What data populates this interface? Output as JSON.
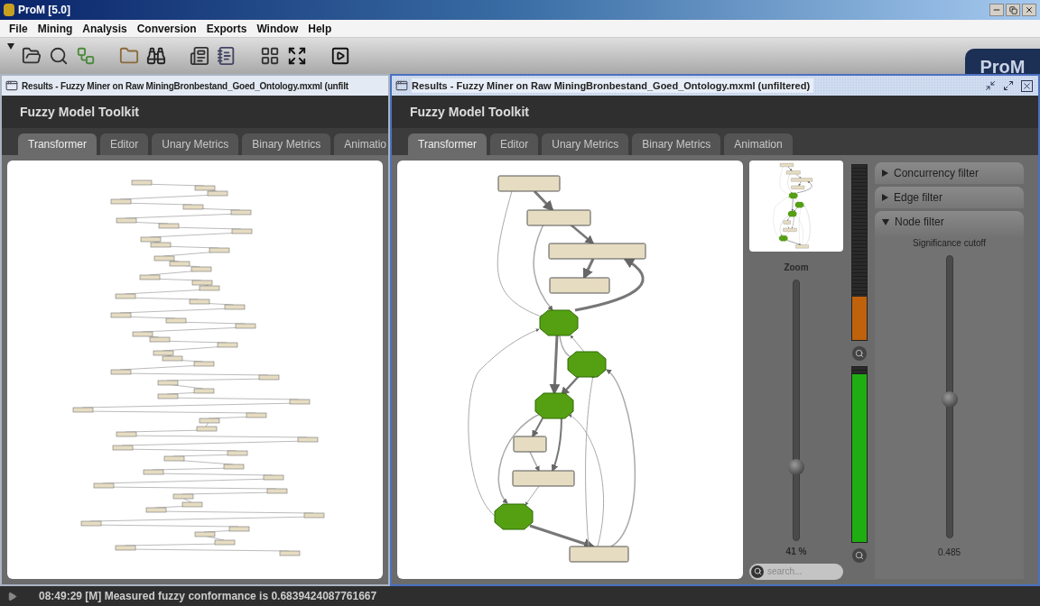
{
  "window": {
    "title": "ProM [5.0]"
  },
  "menu": [
    "File",
    "Mining",
    "Analysis",
    "Conversion",
    "Exports",
    "Window",
    "Help"
  ],
  "logo": "ProM",
  "frames": [
    {
      "title": "Results - Fuzzy Miner on Raw MiningBronbestand_Goed_Ontology.mxml (unfilt",
      "active": false,
      "toolkit": "Fuzzy Model Toolkit",
      "tabs": [
        {
          "label": "Transformer",
          "selected": true
        },
        {
          "label": "Editor",
          "selected": false
        },
        {
          "label": "Unary Metrics",
          "selected": false
        },
        {
          "label": "Binary Metrics",
          "selected": false
        },
        {
          "label": "Animatio",
          "selected": false
        }
      ]
    },
    {
      "title": "Results - Fuzzy Miner on Raw MiningBronbestand_Goed_Ontology.mxml (unfiltered)",
      "active": true,
      "toolkit": "Fuzzy Model Toolkit",
      "tabs": [
        {
          "label": "Transformer",
          "selected": true
        },
        {
          "label": "Editor",
          "selected": false
        },
        {
          "label": "Unary Metrics",
          "selected": false
        },
        {
          "label": "Binary Metrics",
          "selected": false
        },
        {
          "label": "Animation",
          "selected": false
        }
      ],
      "zoom": {
        "label": "Zoom",
        "level": 0.28,
        "reading": "41 %"
      },
      "search": {
        "placeholder": "search..."
      },
      "meters": [
        {
          "level": 0.25,
          "color": "#c0620c"
        },
        {
          "level": 0.96,
          "color": "#1fae12"
        }
      ],
      "filters": [
        {
          "label": "Concurrency filter",
          "expanded": false
        },
        {
          "label": "Edge filter",
          "expanded": false
        },
        {
          "label": "Node filter",
          "expanded": true,
          "slider": {
            "label": "Significance cutoff",
            "level": 0.49,
            "reading": "0.485"
          }
        }
      ]
    }
  ],
  "status_bar": {
    "message": "08:49:29 [M] Measured fuzzy conformance is 0.6839424087761667"
  }
}
